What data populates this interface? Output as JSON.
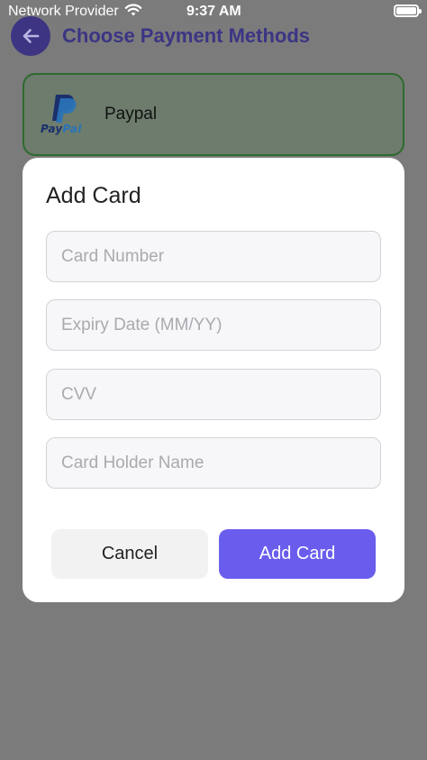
{
  "status_bar": {
    "carrier": "Network Provider",
    "time": "9:37 AM",
    "wifi_icon": "wifi-icon",
    "battery_icon": "battery-icon"
  },
  "header": {
    "back_icon": "arrow-left-icon",
    "title": "Choose Payment Methods"
  },
  "payment_options": [
    {
      "label": "Paypal",
      "logo_pay": "Pay",
      "logo_pal": "Pal",
      "selected": true
    }
  ],
  "modal": {
    "title": "Add Card",
    "fields": {
      "card_number": {
        "placeholder": "Card Number",
        "value": ""
      },
      "expiry": {
        "placeholder": "Expiry Date (MM/YY)",
        "value": ""
      },
      "cvv": {
        "placeholder": "CVV",
        "value": ""
      },
      "holder": {
        "placeholder": "Card Holder Name",
        "value": ""
      }
    },
    "cancel_label": "Cancel",
    "submit_label": "Add Card"
  },
  "colors": {
    "accent": "#6a5ded",
    "header_title": "#3b3584",
    "selected_border": "#2e6a2e",
    "overlay": "#7b7b7b"
  }
}
